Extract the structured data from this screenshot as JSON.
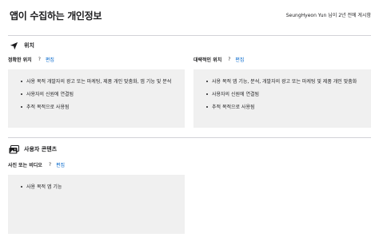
{
  "header": {
    "title": "앱이 수집하는 개인정보",
    "meta": "SeungHyeon Yun 님이 2년 전에 게시함"
  },
  "sections": [
    {
      "title": "위치",
      "icon": "location-arrow-icon",
      "columns": [
        {
          "title": "정확한 위치",
          "help": "?",
          "edit": "편집",
          "items": [
            "사용 목적 개발자의 광고 또는 마케팅, 제품 개인 맞춤화, 앱 기능 및 분석",
            "사용자의 신원에 연결됨",
            "추적 목적으로 사용됨"
          ]
        },
        {
          "title": "대략적인 위치",
          "help": "?",
          "edit": "편집",
          "items": [
            "사용 목적 앱 기능, 분석, 개발자의 광고 또는 마케팅 및 제품 개인 맞춤화",
            "사용자의 신원에 연결됨",
            "추적 목적으로 사용됨"
          ]
        }
      ]
    },
    {
      "title": "사용자 콘텐츠",
      "icon": "photos-icon",
      "columns": [
        {
          "title": "사진 또는 비디오",
          "help": "?",
          "edit": "편집",
          "items": [
            "사용 목적 앱 기능"
          ]
        }
      ]
    }
  ],
  "colors": {
    "accent": "#0066cc",
    "panel": "#f0f0f0",
    "divider": "#d2d2d7",
    "text": "#1d1d1f"
  }
}
